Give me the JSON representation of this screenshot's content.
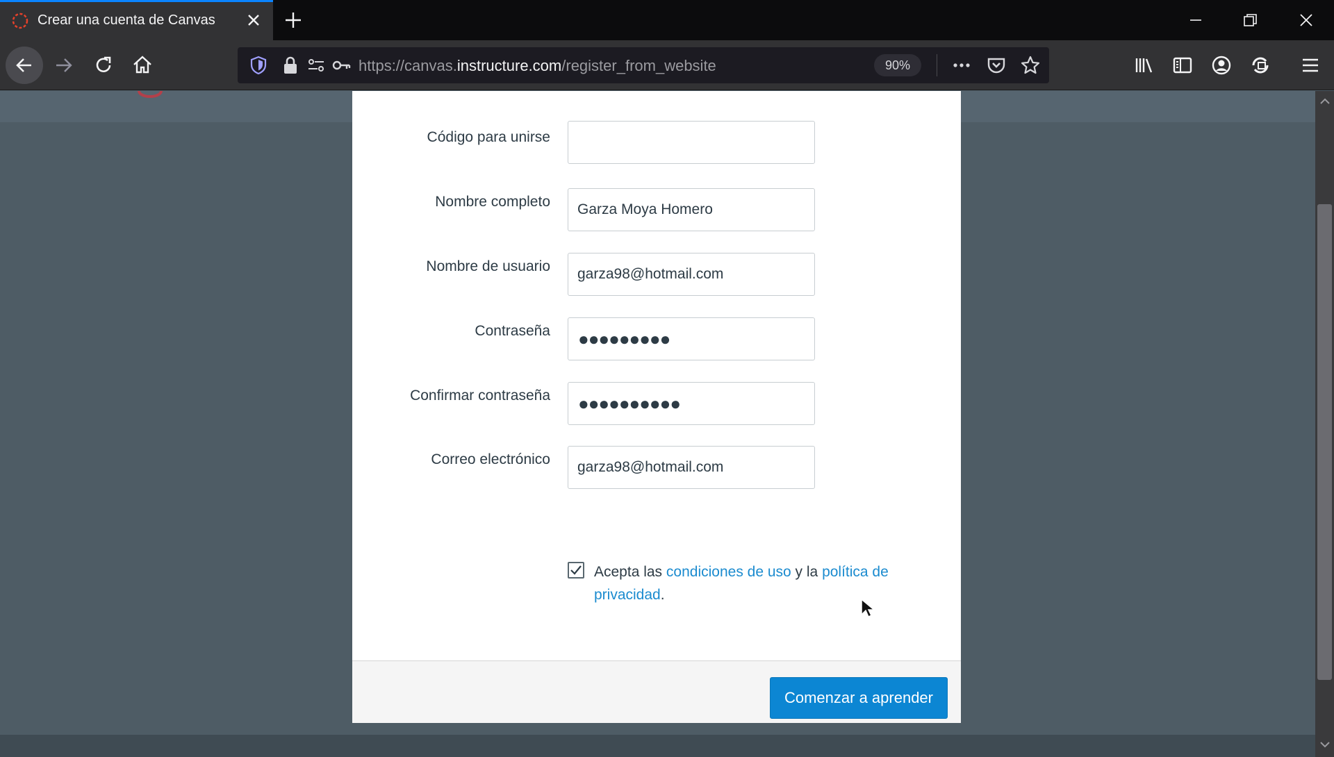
{
  "browser": {
    "tab": {
      "title": "Crear una cuenta de Canvas",
      "favicon": "canvas-logo-icon"
    },
    "url": {
      "scheme_and_sub": "https://canvas.",
      "host": "instructure.com",
      "path": "/register_from_website"
    },
    "zoom": "90%",
    "accent_color": "#0a84ff"
  },
  "form": {
    "join_code": {
      "label": "Código para unirse",
      "value": ""
    },
    "full_name": {
      "label": "Nombre completo",
      "value": "Garza Moya Homero"
    },
    "username": {
      "label": "Nombre de usuario",
      "value": "garza98@hotmail.com"
    },
    "password": {
      "label": "Contraseña",
      "masked": "●●●●●●●●●"
    },
    "confirm_password": {
      "label": "Confirmar contraseña",
      "masked": "●●●●●●●●●●"
    },
    "email": {
      "label": "Correo electrónico",
      "value": "garza98@hotmail.com"
    },
    "terms": {
      "checked": true,
      "prefix": "Acepta las ",
      "terms_link": "condiciones de uso",
      "middle": " y la ",
      "privacy_link": "política de privacidad",
      "suffix": "."
    },
    "submit_label": "Comenzar a aprender",
    "button_color": "#0c86d3",
    "link_color": "#1b8bcf"
  }
}
